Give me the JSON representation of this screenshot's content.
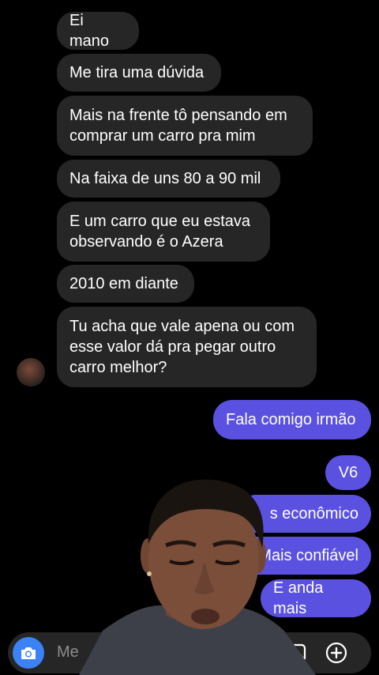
{
  "incoming_messages": [
    {
      "text": "Ei mano"
    },
    {
      "text": "Me tira uma dúvida"
    },
    {
      "lines": [
        "Mais na frente tô pensando em",
        "comprar um carro pra mim"
      ]
    },
    {
      "text": "Na faixa de uns 80 a 90 mil"
    },
    {
      "lines": [
        "E um carro que eu estava",
        "observando é o Azera"
      ]
    },
    {
      "text": "2010 em diante"
    },
    {
      "lines": [
        "Tu acha que vale apena ou com",
        "esse valor dá pra pegar outro",
        "carro melhor?"
      ]
    }
  ],
  "outgoing_messages": [
    {
      "text": "Fala comigo irmão"
    },
    {
      "text": "V6"
    },
    {
      "text": "s econômico"
    },
    {
      "text": "Mais confiável"
    },
    {
      "text": "E anda mais"
    }
  ],
  "composer": {
    "placeholder": "Me"
  },
  "colors": {
    "incoming_bubble": "#262626",
    "outgoing_bubble": "#5b51e0",
    "camera_button": "#3b82f6"
  },
  "icons": {
    "camera": "camera-icon",
    "gallery": "gallery-icon",
    "add": "plus-circle-icon"
  }
}
